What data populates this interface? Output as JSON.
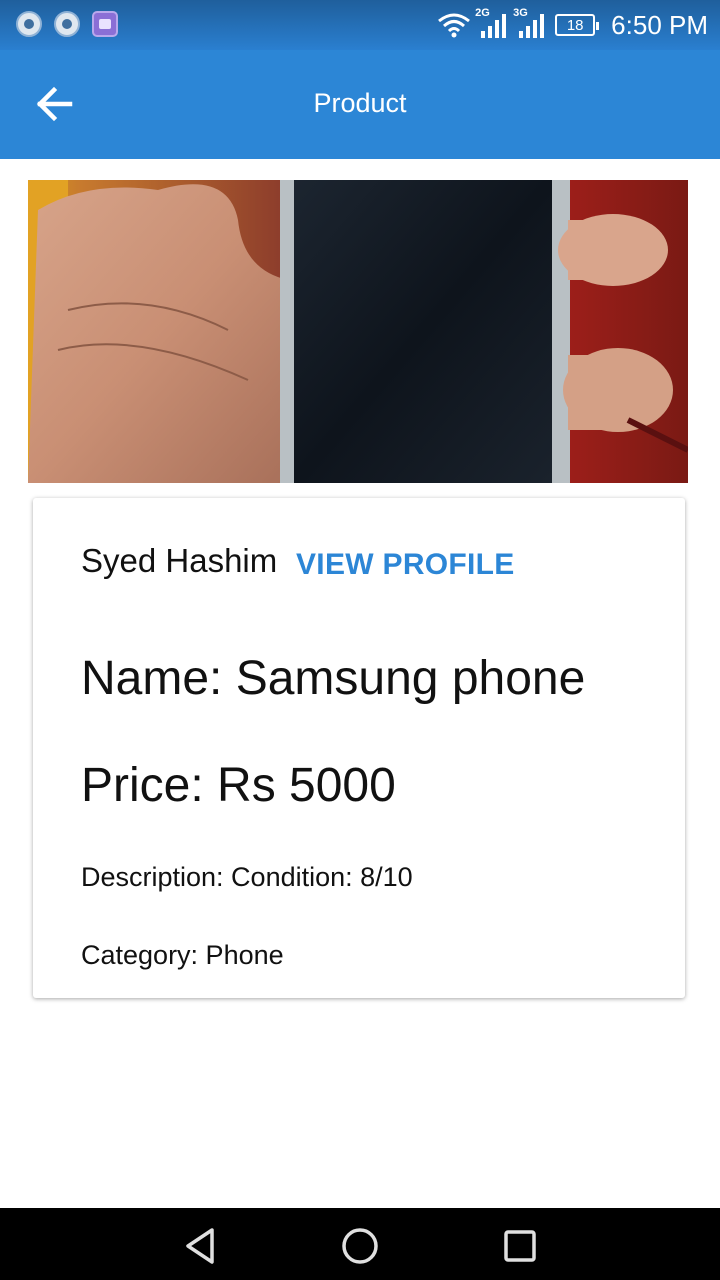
{
  "status_bar": {
    "network_1": "2G",
    "network_2": "3G",
    "battery": "18",
    "time": "6:50 PM"
  },
  "app_bar": {
    "title": "Product",
    "back_icon": "arrow-left-icon"
  },
  "colors": {
    "primary": "#2c86d6",
    "status_bar": "#2a7fd0",
    "link": "#2c86d6",
    "nav_bar": "#000000"
  },
  "product": {
    "seller_name": "Syed Hashim",
    "view_profile_label": "VIEW PROFILE",
    "name": "Name: Samsung phone",
    "price": "Price: Rs 5000",
    "description": "Description: Condition: 8/10",
    "category": "Category: Phone"
  },
  "nav_bar": {
    "back_icon": "triangle-back-icon",
    "home_icon": "circle-home-icon",
    "recents_icon": "square-recents-icon"
  }
}
